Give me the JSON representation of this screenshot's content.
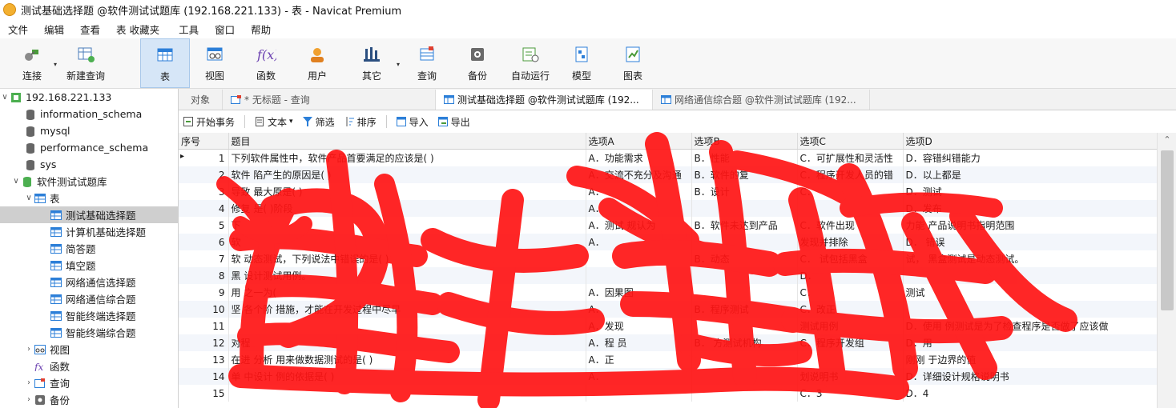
{
  "window": {
    "title": "测试基础选择题 @软件测试试题库 (192.168.221.133) - 表 - Navicat Premium"
  },
  "menu": [
    "文件",
    "编辑",
    "查看",
    "表",
    "收藏夹",
    "工具",
    "窗口",
    "帮助"
  ],
  "toolbar": [
    {
      "label": "连接",
      "icon": "connect-icon"
    },
    {
      "label": "新建查询",
      "icon": "new-query-icon"
    },
    {
      "label": "表",
      "icon": "table-icon",
      "active": true
    },
    {
      "label": "视图",
      "icon": "view-icon"
    },
    {
      "label": "函数",
      "icon": "function-icon"
    },
    {
      "label": "用户",
      "icon": "user-icon"
    },
    {
      "label": "其它",
      "icon": "other-icon"
    },
    {
      "label": "查询",
      "icon": "query-icon"
    },
    {
      "label": "备份",
      "icon": "backup-icon"
    },
    {
      "label": "自动运行",
      "icon": "auto-run-icon"
    },
    {
      "label": "模型",
      "icon": "model-icon"
    },
    {
      "label": "图表",
      "icon": "chart-icon"
    }
  ],
  "sidebar": {
    "connection": "192.168.221.133",
    "databases": [
      "information_schema",
      "mysql",
      "performance_schema",
      "sys"
    ],
    "open_db": "软件测试试题库",
    "tables_node": "表",
    "tables": [
      "测试基础选择题",
      "计算机基础选择题",
      "简答题",
      "填空题",
      "网络通信选择题",
      "网络通信综合题",
      "智能终端选择题",
      "智能终端综合题"
    ],
    "selected_table": "测试基础选择题",
    "views": "视图",
    "functions": "函数",
    "queries": "查询",
    "backups": "备份"
  },
  "tabs": [
    "对象",
    "* 无标题 - 查询",
    "测试基础选择题 @软件测试试题库 (192...",
    "网络通信综合题 @软件测试试题库 (192..."
  ],
  "grid_toolbar": {
    "begin_tx": "开始事务",
    "text": "文本",
    "filter": "筛选",
    "sort": "排序",
    "import": "导入",
    "export": "导出"
  },
  "columns": [
    "序号",
    "题目",
    "选项A",
    "选项B",
    "选项C",
    "选项D"
  ],
  "rows": [
    [
      "1",
      "下列软件属性中，软件产品首要满足的应该是( )",
      "A．功能需求",
      "B．性能",
      "C．可扩展性和灵活性",
      "D．容错纠错能力"
    ],
    [
      "2",
      "软件 陷产生的原因是( )",
      "A．交流不充分及沟通",
      "B．软件的复",
      "C．程序开发人员的错",
      "D．以上都是"
    ],
    [
      "3",
      "导致 最大原是( )",
      "A．",
      "B．设计",
      "C．",
      "D．测试"
    ],
    [
      "4",
      "修复 是( )阶段",
      "A．",
      "",
      "",
      "D．发布"
    ],
    [
      "5",
      "下",
      "A．测试 规认为",
      "B．软件未达到产品",
      "C．软件出现",
      "力能 产品说明书指明范围"
    ],
    [
      "6",
      "软",
      "A．",
      "",
      "发现并排除",
      "D． 错误"
    ],
    [
      "7",
      "软 动态测试，下列说法中错误的是( )",
      "",
      "B．动态",
      "C． 试包括黑盒",
      "试， 黑盒测试是动态测试。"
    ],
    [
      "8",
      "黑 设计测试用例。",
      "",
      "",
      "D．",
      ""
    ],
    [
      "9",
      "用 之一为(",
      "A．因果图",
      "",
      "C．",
      "测试"
    ],
    [
      "10",
      "坚 各个阶 措施，才能在开发过程中尽早",
      "A．",
      "B．程序测试",
      "C．改正",
      ""
    ],
    [
      "11",
      "",
      "A．发现",
      "",
      "测试用例",
      "D．使用 例测试是为了检查程序是否做了应该做"
    ],
    [
      "12",
      "对程",
      "A．程 员",
      "B． 方测试机构",
      "C．程序开发组",
      "D．用"
    ],
    [
      "13",
      "在进 分析 用来做数据测试的是( )",
      "A．正",
      "",
      "",
      "刚刚 于边界的值"
    ],
    [
      "14",
      "单 中设计 例的依据是( )",
      "A．",
      "",
      "划说明书",
      "D．详细设计规格说明书"
    ],
    [
      "15",
      "",
      "",
      "",
      "C．3",
      "D．4"
    ]
  ],
  "colors": {
    "accent": "#2c7fd8",
    "scribble": "#ff1414",
    "selection": "#cfcfcf"
  }
}
